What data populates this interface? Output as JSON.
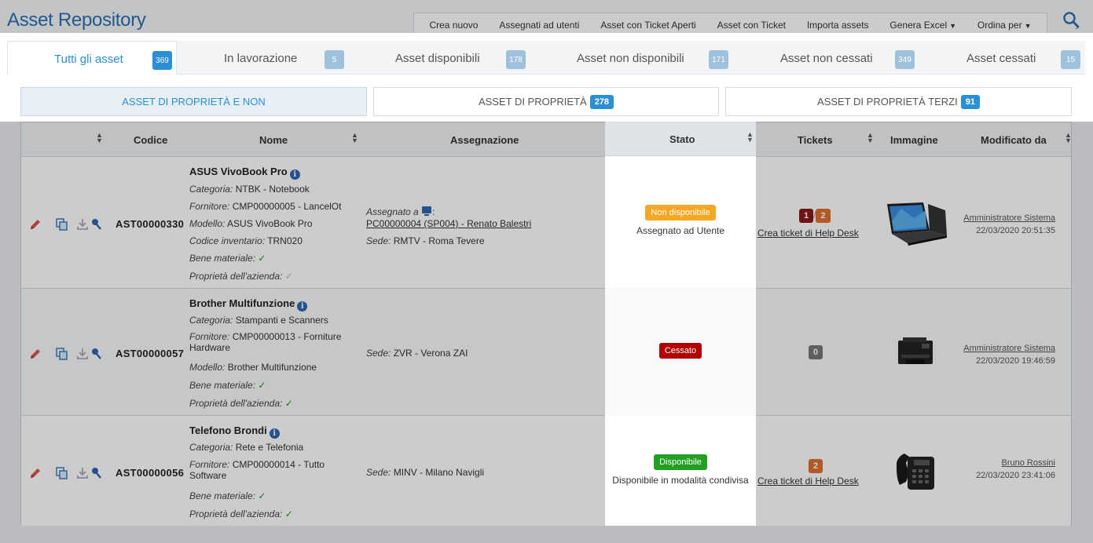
{
  "app": {
    "title": "Asset Repository"
  },
  "topmenu": {
    "items": [
      "Crea nuovo",
      "Assegnati ad utenti",
      "Asset con Ticket Aperti",
      "Asset con Ticket",
      "Importa assets"
    ],
    "genera_excel": "Genera Excel",
    "ordina_per": "Ordina per"
  },
  "tabs": [
    {
      "label": "Tutti gli asset",
      "count": "369"
    },
    {
      "label": "In lavorazione",
      "count": "5"
    },
    {
      "label": "Asset disponibili",
      "count": "178"
    },
    {
      "label": "Asset non disponibili",
      "count": "171"
    },
    {
      "label": "Asset non cessati",
      "count": "349"
    },
    {
      "label": "Asset cessati",
      "count": "15"
    }
  ],
  "segments": [
    {
      "label": "ASSET DI PROPRIETÀ E NON",
      "count": ""
    },
    {
      "label": "ASSET DI PROPRIETÀ",
      "count": "278"
    },
    {
      "label": "ASSET DI PROPRIETÀ TERZI",
      "count": "91"
    }
  ],
  "columns": {
    "codice": "Codice",
    "nome": "Nome",
    "assegnazione": "Assegnazione",
    "stato": "Stato",
    "tickets": "Tickets",
    "immagine": "Immagine",
    "modificato_da": "Modificato da"
  },
  "labels": {
    "categoria": "Categoria:",
    "fornitore": "Fornitore:",
    "modello": "Modello:",
    "codice_inventario": "Codice inventario:",
    "bene_materiale": "Bene materiale:",
    "proprieta": "Proprietà dell'azienda:",
    "assegnato_a": "Assegnato a",
    "sede": "Sede:",
    "crea_ticket": "Crea ticket di Help Desk",
    "check": "✓"
  },
  "rows": [
    {
      "codice": "AST00000330",
      "nome": "ASUS VivoBook Pro",
      "categoria": "NTBK - Notebook",
      "fornitore": "CMP00000005 - LancelOt",
      "modello": "ASUS VivoBook Pro",
      "codice_inventario": "TRN020",
      "assegnato": "PC00000004 (SP004) - Renato Balestri",
      "sede": "RMTV - Roma Tevere",
      "stato": "Non disponibile",
      "stato_color": "#f5a623",
      "stato_sub": "Assegnato ad Utente",
      "ticket_a": "1",
      "ticket_sep": "/",
      "ticket_b": "2",
      "modby": "Amministratore Sistema",
      "moddate": "22/03/2020 20:51:35"
    },
    {
      "codice": "AST00000057",
      "nome": "Brother Multifunzione",
      "categoria": "Stampanti e Scanners",
      "fornitore": "CMP00000013 - Forniture Hardware",
      "modello": "Brother Multifunzione",
      "sede": "ZVR - Verona ZAI",
      "stato": "Cessato",
      "stato_color": "#b00000",
      "ticket_zero": "0",
      "modby": "Amministratore Sistema",
      "moddate": "22/03/2020 19:46:59"
    },
    {
      "codice": "AST00000056",
      "nome": "Telefono Brondi",
      "categoria": "Rete e Telefonia",
      "fornitore": "CMP00000014 - Tutto Software",
      "sede": "MINV - Milano Navigli",
      "stato": "Disponibile",
      "stato_color": "#22a022",
      "stato_sub": "Disponibile in modalità condivisa",
      "ticket_b": "2",
      "modby": "Bruno Rossini",
      "moddate": "22/03/2020 23:41:06"
    }
  ]
}
